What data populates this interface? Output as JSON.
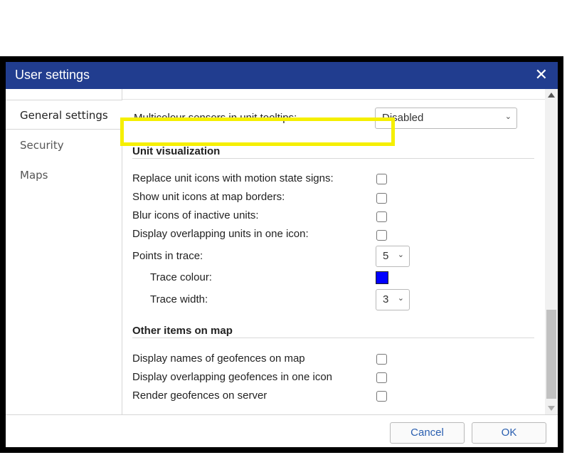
{
  "dialog": {
    "title": "User settings",
    "close_glyph": "✕"
  },
  "sidebar": {
    "items": [
      {
        "label": "General settings",
        "active": true
      },
      {
        "label": "Security"
      },
      {
        "label": "Maps"
      }
    ]
  },
  "settings": {
    "multicolour_sensors": {
      "label": "Multicolour sensors in unit tooltips:",
      "value": "Disabled"
    },
    "unit_visualization": {
      "heading": "Unit visualization",
      "replace_icons": "Replace unit icons with motion state signs:",
      "show_at_borders": "Show unit icons at map borders:",
      "blur_inactive": "Blur icons of inactive units:",
      "overlapping_units": "Display overlapping units in one icon:",
      "points_in_trace": {
        "label": "Points in trace:",
        "value": "5"
      },
      "trace_colour": {
        "label": "Trace colour:",
        "color": "#0000ff"
      },
      "trace_width": {
        "label": "Trace width:",
        "value": "3"
      }
    },
    "other_items": {
      "heading": "Other items on map",
      "geofence_names": "Display names of geofences on map",
      "overlapping_geofences": "Display overlapping geofences in one icon",
      "render_server": "Render geofences on server"
    }
  },
  "footer": {
    "cancel_label": "Cancel",
    "ok_label": "OK"
  },
  "colors": {
    "titlebar": "#213d8f",
    "highlight": "#f5ef00",
    "link_blue": "#2a5fb0"
  }
}
